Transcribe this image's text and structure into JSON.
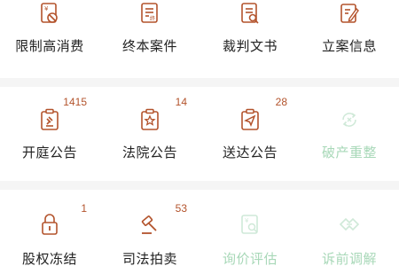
{
  "colors": {
    "accent": "#b3532c",
    "disabled": "#a8d8b8",
    "label": "#222222",
    "divider": "#f5f5f5"
  },
  "row1": [
    {
      "label": "限制高消费",
      "count": "",
      "icon": "restricted-spending-icon"
    },
    {
      "label": "终本案件",
      "count": "",
      "icon": "closed-case-icon"
    },
    {
      "label": "裁判文书",
      "count": "",
      "icon": "judgment-document-icon"
    },
    {
      "label": "立案信息",
      "count": "",
      "icon": "filing-info-icon"
    }
  ],
  "row2": [
    {
      "label": "开庭公告",
      "count": "1415",
      "icon": "court-hearing-icon"
    },
    {
      "label": "法院公告",
      "count": "14",
      "icon": "court-notice-icon"
    },
    {
      "label": "送达公告",
      "count": "28",
      "icon": "service-notice-icon"
    },
    {
      "label": "破产重整",
      "count": "",
      "icon": "bankruptcy-reorganization-icon"
    }
  ],
  "row3": [
    {
      "label": "股权冻结",
      "count": "1",
      "icon": "lock-icon"
    },
    {
      "label": "司法拍卖",
      "count": "53",
      "icon": "gavel-icon"
    },
    {
      "label": "询价评估",
      "count": "",
      "icon": "price-inquiry-icon"
    },
    {
      "label": "诉前调解",
      "count": "",
      "icon": "mediation-icon"
    }
  ]
}
